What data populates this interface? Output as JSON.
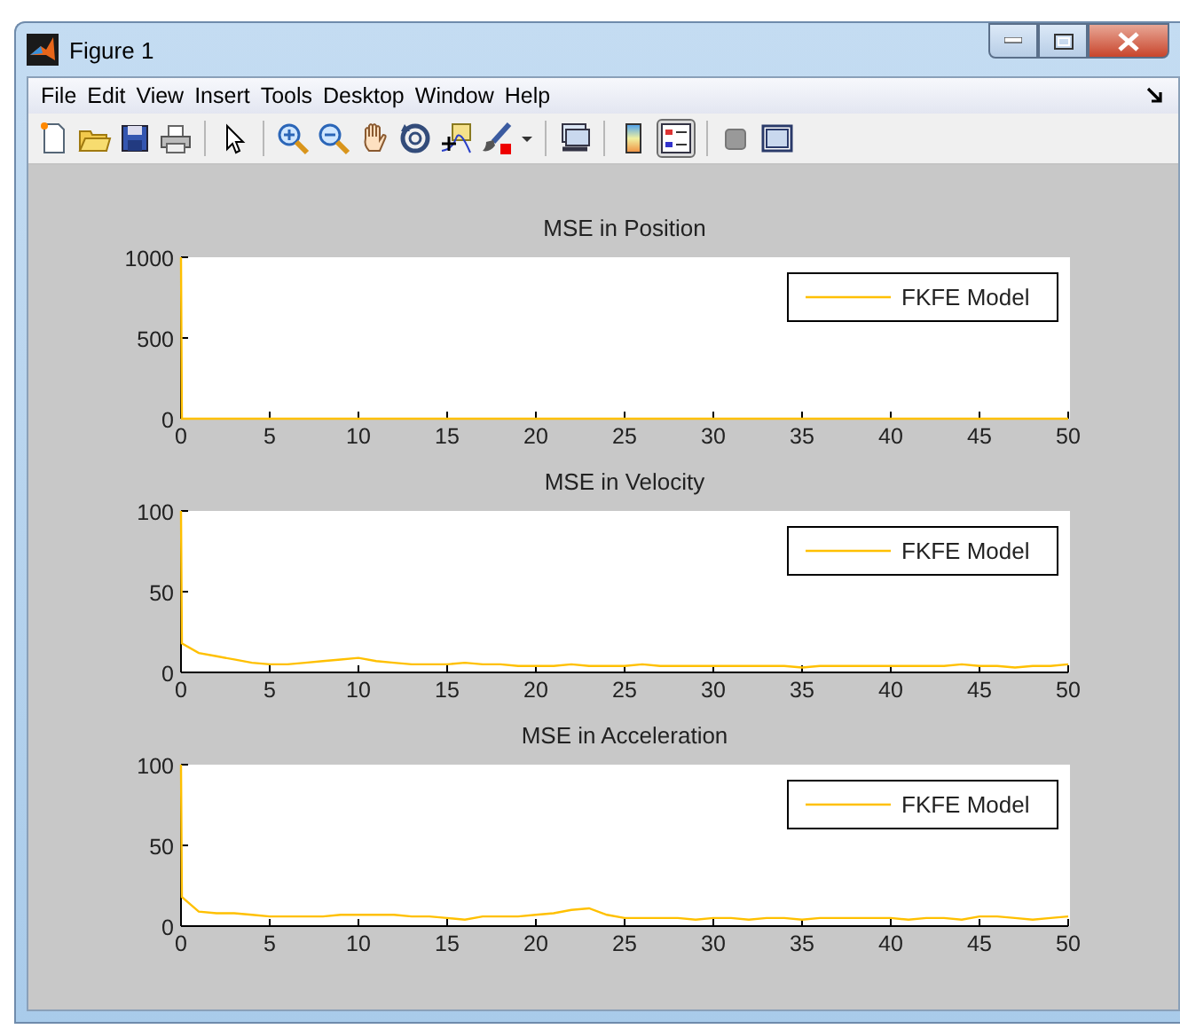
{
  "window": {
    "title": "Figure 1"
  },
  "menu": [
    "File",
    "Edit",
    "View",
    "Insert",
    "Tools",
    "Desktop",
    "Window",
    "Help"
  ],
  "toolbar": {
    "legend_pressed": true
  },
  "subplots": [
    {
      "chart_data": {
        "type": "line",
        "title": "MSE in Position",
        "xlim": [
          0,
          50
        ],
        "ylim": [
          0,
          1000
        ],
        "xticks": [
          0,
          5,
          10,
          15,
          20,
          25,
          30,
          35,
          40,
          45,
          50
        ],
        "yticks": [
          0,
          500,
          1000
        ],
        "x": [
          0,
          0.05,
          1,
          2,
          3,
          4,
          5,
          6,
          7,
          8,
          9,
          10,
          11,
          12,
          13,
          14,
          15,
          16,
          17,
          18,
          19,
          20,
          21,
          22,
          23,
          24,
          25,
          26,
          27,
          28,
          29,
          30,
          31,
          32,
          33,
          34,
          35,
          36,
          37,
          38,
          39,
          40,
          41,
          42,
          43,
          44,
          45,
          46,
          47,
          48,
          49,
          50
        ],
        "series": [
          {
            "name": "FKFE Model",
            "color": "#ffc000",
            "values": [
              1000,
              0,
              0,
              0,
              0,
              0,
              0,
              0,
              0,
              0,
              0,
              0,
              0,
              0,
              0,
              0,
              0,
              0,
              0,
              0,
              0,
              0,
              0,
              0,
              0,
              0,
              0,
              0,
              0,
              0,
              0,
              0,
              0,
              0,
              0,
              0,
              0,
              0,
              0,
              0,
              0,
              0,
              0,
              0,
              0,
              0,
              0,
              0,
              0,
              0,
              0,
              0
            ]
          }
        ]
      }
    },
    {
      "chart_data": {
        "type": "line",
        "title": "MSE in Velocity",
        "xlim": [
          0,
          50
        ],
        "ylim": [
          0,
          100
        ],
        "xticks": [
          0,
          5,
          10,
          15,
          20,
          25,
          30,
          35,
          40,
          45,
          50
        ],
        "yticks": [
          0,
          50,
          100
        ],
        "x": [
          0,
          0.05,
          1,
          2,
          3,
          4,
          5,
          6,
          7,
          8,
          9,
          10,
          11,
          12,
          13,
          14,
          15,
          16,
          17,
          18,
          19,
          20,
          21,
          22,
          23,
          24,
          25,
          26,
          27,
          28,
          29,
          30,
          31,
          32,
          33,
          34,
          35,
          36,
          37,
          38,
          39,
          40,
          41,
          42,
          43,
          44,
          45,
          46,
          47,
          48,
          49,
          50
        ],
        "series": [
          {
            "name": "FKFE Model",
            "color": "#ffc000",
            "values": [
              100,
              18,
              12,
              10,
              8,
              6,
              5,
              5,
              6,
              7,
              8,
              9,
              7,
              6,
              5,
              5,
              5,
              6,
              5,
              5,
              4,
              4,
              4,
              5,
              4,
              4,
              4,
              5,
              4,
              4,
              4,
              4,
              4,
              4,
              4,
              4,
              3,
              4,
              4,
              4,
              4,
              4,
              4,
              4,
              4,
              5,
              4,
              4,
              3,
              4,
              4,
              5
            ]
          }
        ]
      }
    },
    {
      "chart_data": {
        "type": "line",
        "title": "MSE in Acceleration",
        "xlim": [
          0,
          50
        ],
        "ylim": [
          0,
          100
        ],
        "xticks": [
          0,
          5,
          10,
          15,
          20,
          25,
          30,
          35,
          40,
          45,
          50
        ],
        "yticks": [
          0,
          50,
          100
        ],
        "x": [
          0,
          0.05,
          1,
          2,
          3,
          4,
          5,
          6,
          7,
          8,
          9,
          10,
          11,
          12,
          13,
          14,
          15,
          16,
          17,
          18,
          19,
          20,
          21,
          22,
          23,
          24,
          25,
          26,
          27,
          28,
          29,
          30,
          31,
          32,
          33,
          34,
          35,
          36,
          37,
          38,
          39,
          40,
          41,
          42,
          43,
          44,
          45,
          46,
          47,
          48,
          49,
          50
        ],
        "series": [
          {
            "name": "FKFE Model",
            "color": "#ffc000",
            "values": [
              100,
              18,
              9,
              8,
              8,
              7,
              6,
              6,
              6,
              6,
              7,
              7,
              7,
              7,
              6,
              6,
              5,
              4,
              6,
              6,
              6,
              7,
              8,
              10,
              11,
              7,
              5,
              5,
              5,
              5,
              4,
              5,
              5,
              4,
              5,
              5,
              4,
              5,
              5,
              5,
              5,
              5,
              4,
              5,
              5,
              4,
              6,
              6,
              5,
              4,
              5,
              6
            ]
          }
        ]
      }
    }
  ]
}
